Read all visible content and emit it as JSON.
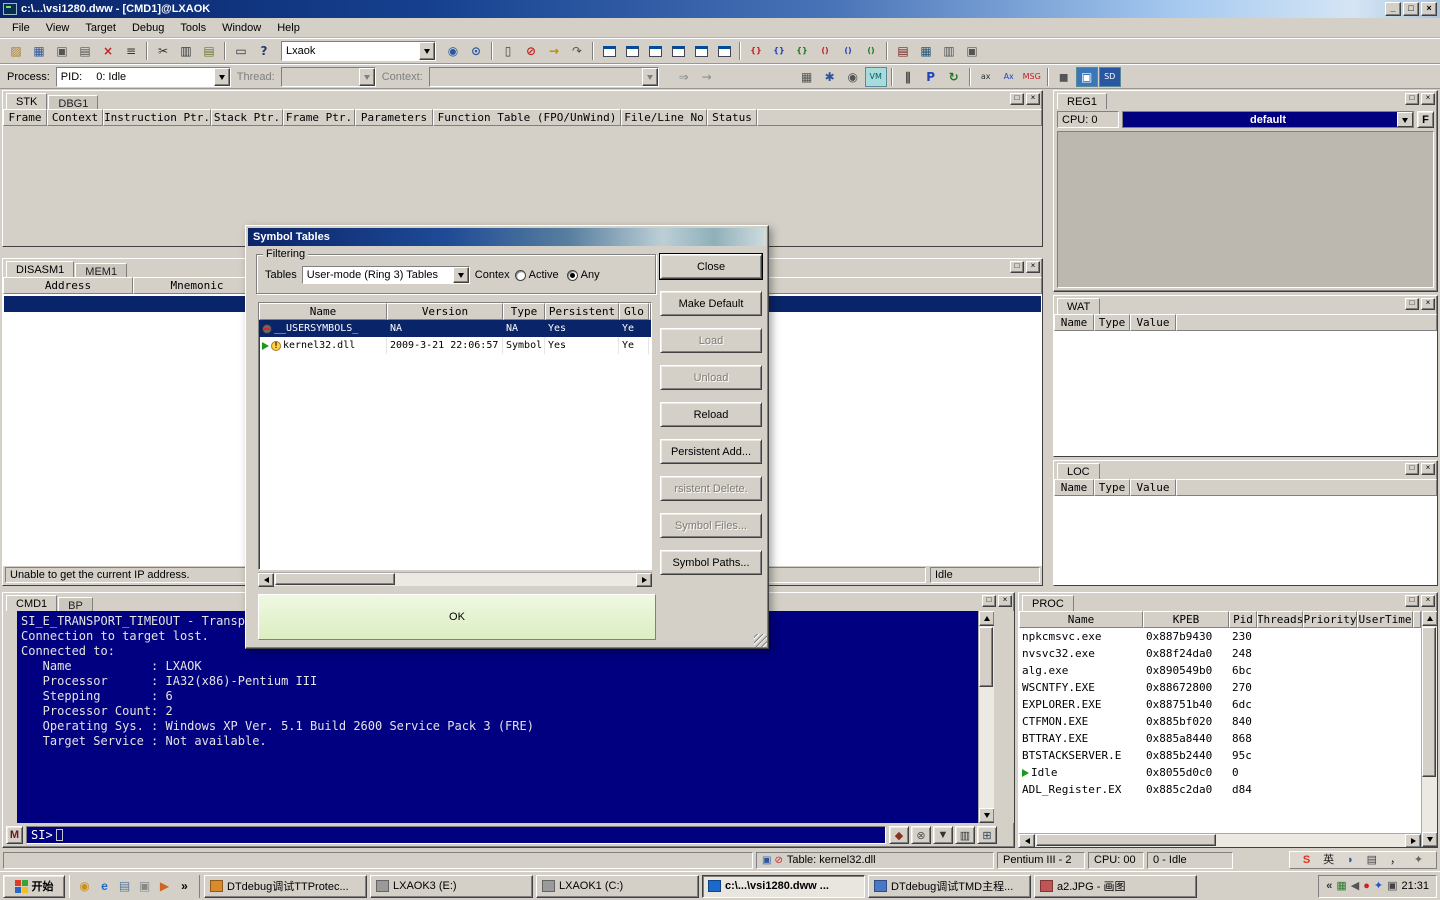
{
  "titlebar": {
    "title": "c:\\...\\vsi1280.dww - [CMD1]@LXAOK",
    "buttons": [
      {
        "name": "minimize-button",
        "glyph": "_"
      },
      {
        "name": "maximize-button",
        "glyph": "□"
      },
      {
        "name": "close-button",
        "glyph": "×"
      }
    ]
  },
  "menu": {
    "items": [
      "File",
      "View",
      "Target",
      "Debug",
      "Tools",
      "Window",
      "Help"
    ]
  },
  "panel_buttons": [
    {
      "name": "panel-maximize-button",
      "glyph": "□"
    },
    {
      "name": "panel-close-button",
      "glyph": "×"
    }
  ],
  "toolbar1": {
    "combo_value": "Lxaok",
    "items": [
      {
        "t": "i",
        "n": "open-file-icon",
        "g": "▨",
        "c": "#a87b2d"
      },
      {
        "t": "i",
        "n": "save-icon",
        "g": "▦",
        "c": "#33589c"
      },
      {
        "t": "i",
        "n": "new-window-icon",
        "g": "▣",
        "c": "#555555"
      },
      {
        "t": "i",
        "n": "cascade-windows-icon",
        "g": "▤",
        "c": "#555555"
      },
      {
        "t": "i",
        "n": "close-window-icon",
        "g": "×",
        "c": "#c22222",
        "b": true
      },
      {
        "t": "i",
        "n": "window-list-icon",
        "g": "≡",
        "c": "#333333"
      },
      {
        "t": "sep"
      },
      {
        "t": "i",
        "n": "cut-icon",
        "g": "✂",
        "c": "#333333"
      },
      {
        "t": "i",
        "n": "copy-icon",
        "g": "▥",
        "c": "#333333"
      },
      {
        "t": "i",
        "n": "paste-icon",
        "g": "▤",
        "c": "#6b7a33"
      },
      {
        "t": "sep"
      },
      {
        "t": "i",
        "n": "print-icon",
        "g": "▭",
        "c": "#333333"
      },
      {
        "t": "i",
        "n": "help-icon",
        "g": "?",
        "c": "#223a77",
        "b": true
      },
      {
        "t": "combo"
      },
      {
        "t": "i",
        "n": "find-window-icon",
        "g": "◉",
        "c": "#2a55a0"
      },
      {
        "t": "i",
        "n": "search-icon",
        "g": "⊙",
        "c": "#2a55a0",
        "b": true
      },
      {
        "t": "sep"
      },
      {
        "t": "i",
        "n": "source-view-icon",
        "g": "▯",
        "c": "#444444"
      },
      {
        "t": "i",
        "n": "stop-debug-icon",
        "g": "⊘",
        "c": "#c22222",
        "b": true
      },
      {
        "t": "i",
        "n": "go-icon",
        "g": "→",
        "c": "#c28a00",
        "b": true
      },
      {
        "t": "i",
        "n": "step-back-icon",
        "g": "↷",
        "c": "#555555"
      },
      {
        "t": "sep"
      },
      {
        "t": "win",
        "n": "disasm-window-icon"
      },
      {
        "t": "win",
        "n": "memory-window-icon"
      },
      {
        "t": "win",
        "n": "stack-window-icon"
      },
      {
        "t": "win",
        "n": "register-window-icon"
      },
      {
        "t": "win",
        "n": "watch-window-icon"
      },
      {
        "t": "win",
        "n": "locals-window-icon"
      },
      {
        "t": "sep"
      },
      {
        "t": "i",
        "n": "step-into-icon",
        "g": "{}",
        "c": "#c22222",
        "b": true
      },
      {
        "t": "i",
        "n": "step-over-icon",
        "g": "{}",
        "c": "#2244bb",
        "b": true
      },
      {
        "t": "i",
        "n": "step-out-icon",
        "g": "{}",
        "c": "#227722",
        "b": true
      },
      {
        "t": "i",
        "n": "trace-into-icon",
        "g": "()",
        "c": "#c22222",
        "b": true
      },
      {
        "t": "i",
        "n": "trace-over-icon",
        "g": "()",
        "c": "#2244bb",
        "b": true
      },
      {
        "t": "i",
        "n": "run-to-cursor-icon",
        "g": "()",
        "c": "#227722",
        "b": true
      },
      {
        "t": "sep"
      },
      {
        "t": "i",
        "n": "breakpoint-list-icon",
        "g": "▤",
        "c": "#772222"
      },
      {
        "t": "i",
        "n": "watch-list-icon",
        "g": "▦",
        "c": "#225577"
      },
      {
        "t": "i",
        "n": "module-list-icon",
        "g": "▥",
        "c": "#555555"
      },
      {
        "t": "i",
        "n": "process-list-icon",
        "g": "▣",
        "c": "#555555"
      }
    ]
  },
  "toolbar2": {
    "process_label": "Process:",
    "pid_prefix": "PID:",
    "pid_value": "0: Idle",
    "thread_label": "Thread:",
    "context_label": "Context:",
    "icons_a": [
      {
        "t": "i",
        "n": "continue-icon",
        "g": "⇒",
        "c": "#8a8a8a"
      },
      {
        "t": "i",
        "n": "run-flag-icon",
        "g": "→",
        "c": "#8a8a8a"
      }
    ],
    "icons_b": [
      {
        "t": "i",
        "n": "layout-icon",
        "g": "▦",
        "c": "#555555"
      },
      {
        "t": "i",
        "n": "settings-gear-icon",
        "g": "✱",
        "c": "#2a55a0"
      },
      {
        "t": "i",
        "n": "snapshot-icon",
        "g": "◉",
        "c": "#555555"
      },
      {
        "t": "i",
        "n": "vm-icon",
        "g": "VM",
        "c": "#005f5f",
        "bg": "#a8dcdc"
      },
      {
        "t": "sep"
      },
      {
        "t": "i",
        "n": "pause-icon",
        "g": "∥",
        "c": "#333333",
        "b": true
      },
      {
        "t": "i",
        "n": "power-icon",
        "g": "P",
        "c": "#2244bb",
        "b": true
      },
      {
        "t": "i",
        "n": "refresh-icon",
        "g": "↻",
        "c": "#227722",
        "b": true
      },
      {
        "t": "sep"
      },
      {
        "t": "i",
        "n": "asm-lower-icon",
        "g": "ax",
        "c": "#333333"
      },
      {
        "t": "i",
        "n": "asm-upper-icon",
        "g": "Ax",
        "c": "#2244bb"
      },
      {
        "t": "i",
        "n": "msg-icon",
        "g": "MSG",
        "c": "#c22222"
      },
      {
        "t": "sep"
      },
      {
        "t": "i",
        "n": "beep-icon",
        "g": "◼",
        "c": "#555555"
      },
      {
        "t": "i",
        "n": "remote-screen-icon",
        "g": "▣",
        "c": "#ffffff",
        "bg": "#3a77b8"
      },
      {
        "t": "i",
        "n": "sd-icon",
        "g": "SD",
        "c": "#ffffff",
        "bg": "#2a55a0"
      }
    ]
  },
  "stk": {
    "tabs": [
      "STK",
      "DBG1"
    ],
    "columns": [
      "Frame",
      "Context",
      "Instruction Ptr.",
      "Stack Ptr.",
      "Frame Ptr.",
      "Parameters",
      "Function Table (FPO/UnWind)",
      "File/Line No",
      "Status"
    ]
  },
  "disasm": {
    "tabs": [
      "DISASM1",
      "MEM1"
    ],
    "columns": [
      "Address",
      "Mnemonic"
    ],
    "status_message": "Unable to get the current IP address.",
    "status_state": "Idle"
  },
  "reg": {
    "tab": "REG1",
    "cpu_label": "CPU: 0",
    "combo_value": "default",
    "f_button": "F"
  },
  "wat": {
    "tab": "WAT",
    "columns": [
      "Name",
      "Type",
      "Value"
    ]
  },
  "loc": {
    "tab": "LOC",
    "columns": [
      "Name",
      "Type",
      "Value"
    ]
  },
  "cmd": {
    "tabs": [
      "CMD1",
      "BP"
    ],
    "lines": [
      "SI_E_TRANSPORT_TIMEOUT - Transpo",
      "Connection to target lost.",
      "Connected to:",
      "   Name           : LXAOK",
      "   Processor      : IA32(x86)-Pentium III",
      "   Stepping       : 6",
      "   Processor Count: 2",
      "   Operating Sys. : Windows XP Ver. 5.1 Build 2600 Service Pack 3 (FRE)",
      "   Target Service : Not available."
    ],
    "m_button": "M",
    "prompt": "SI>",
    "buttons": [
      {
        "name": "history-icon",
        "glyph": "◆",
        "color": "#883322"
      },
      {
        "name": "clear-console-icon",
        "glyph": "⊗",
        "color": "#555555"
      },
      {
        "name": "save-log-icon",
        "glyph": "▼",
        "color": "#333333"
      },
      {
        "name": "log-options-icon",
        "glyph": "▥",
        "color": "#333333"
      },
      {
        "name": "console-mode-icon",
        "glyph": "⊞",
        "color": "#334455"
      }
    ]
  },
  "proc": {
    "tab": "PROC",
    "columns": [
      "Name",
      "KPEB",
      "Pid",
      "Threads",
      "Priority",
      "UserTime"
    ],
    "rows": [
      {
        "name": "npkcmsvc.exe",
        "kpeb": "0x887b9430",
        "pid": "230",
        "threads": "",
        "priority": "",
        "usertime": ""
      },
      {
        "name": "nvsvc32.exe",
        "kpeb": "0x88f24da0",
        "pid": "248",
        "threads": "",
        "priority": "",
        "usertime": ""
      },
      {
        "name": "alg.exe",
        "kpeb": "0x890549b0",
        "pid": "6bc",
        "threads": "",
        "priority": "",
        "usertime": ""
      },
      {
        "name": "WSCNTFY.EXE",
        "kpeb": "0x88672800",
        "pid": "270",
        "threads": "",
        "priority": "",
        "usertime": ""
      },
      {
        "name": "EXPLORER.EXE",
        "kpeb": "0x88751b40",
        "pid": "6dc",
        "threads": "",
        "priority": "",
        "usertime": ""
      },
      {
        "name": "CTFMON.EXE",
        "kpeb": "0x885bf020",
        "pid": "840",
        "threads": "",
        "priority": "",
        "usertime": ""
      },
      {
        "name": "BTTRAY.EXE",
        "kpeb": "0x885a8440",
        "pid": "868",
        "threads": "",
        "priority": "",
        "usertime": ""
      },
      {
        "name": "BTSTACKSERVER.E",
        "kpeb": "0x885b2440",
        "pid": "95c",
        "threads": "",
        "priority": "",
        "usertime": ""
      },
      {
        "name": "Idle",
        "kpeb": "0x8055d0c0",
        "pid": "0",
        "threads": "",
        "priority": "",
        "usertime": "",
        "current": true
      },
      {
        "name": "ADL_Register.EX",
        "kpeb": "0x885c2da0",
        "pid": "d84",
        "threads": "",
        "priority": "",
        "usertime": ""
      }
    ]
  },
  "dialog": {
    "title": "Symbol Tables",
    "filtering": {
      "title": "Filtering",
      "tables_label": "Tables",
      "tables_value": "User-mode (Ring 3) Tables",
      "context_label": "Contex",
      "radios": [
        {
          "label": "Active",
          "selected": false
        },
        {
          "label": "Any",
          "selected": true
        }
      ]
    },
    "columns": [
      "Name",
      "Version",
      "Type",
      "Persistent",
      "Glo"
    ],
    "rows": [
      {
        "icon": "user",
        "name": "__USERSYMBOLS_",
        "version": "NA",
        "type": "NA",
        "persistent": "Yes",
        "global": "Ye",
        "selected": true
      },
      {
        "icon": "module",
        "name": "kernel32.dll",
        "version": "2009-3-21 22:06:57",
        "type": "Symbol",
        "persistent": "Yes",
        "global": "Ye",
        "selected": false
      }
    ],
    "buttons": [
      {
        "name": "close-button",
        "label": "Close",
        "def": true
      },
      {
        "name": "make-default-button",
        "label": "Make Default"
      },
      {
        "name": "load-button",
        "label": "Load",
        "disabled": true
      },
      {
        "name": "unload-button",
        "label": "Unload",
        "disabled": true
      },
      {
        "name": "reload-button",
        "label": "Reload"
      },
      {
        "name": "persistent-add-button",
        "label": "Persistent Add..."
      },
      {
        "name": "persistent-delete-button",
        "label": "rsistent Delete.",
        "disabled": true
      },
      {
        "name": "symbol-files-button",
        "label": "Symbol Files...",
        "disabled": true
      },
      {
        "name": "symbol-paths-button",
        "label": "Symbol Paths..."
      }
    ],
    "ok_label": "OK"
  },
  "statusbar": {
    "info_icons": [
      {
        "name": "target-computer-icon",
        "glyph": "▣",
        "color": "#2a55a0"
      },
      {
        "name": "break-disabled-icon",
        "glyph": "⊘",
        "color": "#cc2222"
      }
    ],
    "table_info": "Table: kernel32.dll",
    "cpu_model": "Pentium III - 2",
    "cpu": "CPU: 00",
    "state": "0 - Idle",
    "lang_items": [
      {
        "name": "sogou-icon",
        "glyph": "S",
        "color": "#dd3322",
        "bold": true
      },
      {
        "name": "ime-language-icon",
        "glyph": "英",
        "color": "#222222"
      },
      {
        "name": "ime-mode-icon",
        "glyph": "◗",
        "color": "#2a55a0"
      },
      {
        "name": "soft-keyboard-icon",
        "glyph": "▤",
        "color": "#444444"
      },
      {
        "name": "punctuation-icon",
        "glyph": "，",
        "color": "#222222"
      },
      {
        "name": "ime-settings-icon",
        "glyph": "✦",
        "color": "#666666"
      }
    ]
  },
  "taskbar": {
    "start_label": "开始",
    "quicklaunch": [
      {
        "name": "quicklaunch-media-icon",
        "glyph": "◉",
        "color": "#c89020"
      },
      {
        "name": "quicklaunch-browser-icon",
        "glyph": "e",
        "color": "#1a6acc",
        "bold": true
      },
      {
        "name": "quicklaunch-desktop-icon",
        "glyph": "▤",
        "color": "#557799"
      },
      {
        "name": "quicklaunch-folder-icon",
        "glyph": "▣",
        "color": "#888888"
      },
      {
        "name": "quicklaunch-player-icon",
        "glyph": "▶",
        "color": "#cc6622"
      }
    ],
    "overflow": "»",
    "buttons": [
      {
        "label": "DTdebug调试TTProtec...",
        "icon_name": "notepad-icon",
        "icon_color": "#d98a2b"
      },
      {
        "label": "LXAOK3 (E:)",
        "icon_name": "drive-icon",
        "icon_color": "#9a9a9a"
      },
      {
        "label": "LXAOK1 (C:)",
        "icon_name": "drive-icon",
        "icon_color": "#9a9a9a"
      },
      {
        "label": "c:\\...\\vsi1280.dww ...",
        "icon_name": "debugger-icon",
        "icon_color": "#1a6acc",
        "active": true
      },
      {
        "label": "DTdebug调试TMD主程...",
        "icon_name": "notepad-icon",
        "icon_color": "#4a78c8"
      },
      {
        "label": "a2.JPG - 画图",
        "icon_name": "paint-icon",
        "icon_color": "#c05555"
      }
    ],
    "tray": {
      "chevron": "«",
      "icons": [
        {
          "name": "tray-network-icon",
          "glyph": "▦",
          "color": "#2a7a2a"
        },
        {
          "name": "tray-volume-icon",
          "glyph": "◀",
          "color": "#555555"
        },
        {
          "name": "tray-antivirus-icon",
          "glyph": "●",
          "color": "#cc2222"
        },
        {
          "name": "tray-bluetooth-icon",
          "glyph": "✦",
          "color": "#2255cc"
        },
        {
          "name": "tray-ime-icon",
          "glyph": "▣",
          "color": "#444444"
        }
      ],
      "time": "21:31"
    }
  }
}
